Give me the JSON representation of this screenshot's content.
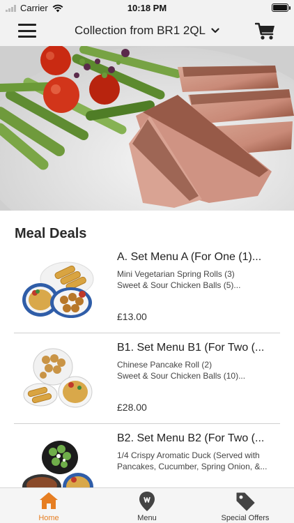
{
  "status_bar": {
    "carrier": "Carrier",
    "time": "10:18 PM",
    "icons": [
      "signal-icon",
      "wifi-icon",
      "battery-icon"
    ]
  },
  "nav": {
    "title": "Collection from BR1 2QL",
    "icons": [
      "hamburger-menu-icon",
      "chevron-down-icon",
      "cart-icon"
    ]
  },
  "hero": {
    "icon": "hero-image"
  },
  "main": {
    "section_title": "Meal Deals",
    "deals": [
      {
        "name": "A. Set Menu A (For One (1)...",
        "desc_line1": "Mini Vegetarian Spring Rolls (3)",
        "desc_line2": "Sweet & Sour Chicken Balls (5)...",
        "price": "£13.00"
      },
      {
        "name": "B1. Set Menu B1 (For Two (...",
        "desc_line1": "Chinese Pancake Roll (2)",
        "desc_line2": "Sweet & Sour Chicken Balls (10)...",
        "price": "£28.00"
      },
      {
        "name": "B2. Set Menu B2 (For Two (...",
        "desc_line1": "1/4 Crispy Aromatic Duck (Served with",
        "desc_line2": "Pancakes, Cucumber, Spring Onion, &...",
        "price": ""
      }
    ]
  },
  "tabs": [
    {
      "label": "Home",
      "icon": "home-icon",
      "active": true
    },
    {
      "label": "Menu",
      "icon": "map-pin-icon",
      "active": false
    },
    {
      "label": "Special Offers",
      "icon": "price-tag-icon",
      "active": false
    }
  ],
  "colors": {
    "accent": "#e67e22",
    "bar_background": "#f2f2f2"
  }
}
